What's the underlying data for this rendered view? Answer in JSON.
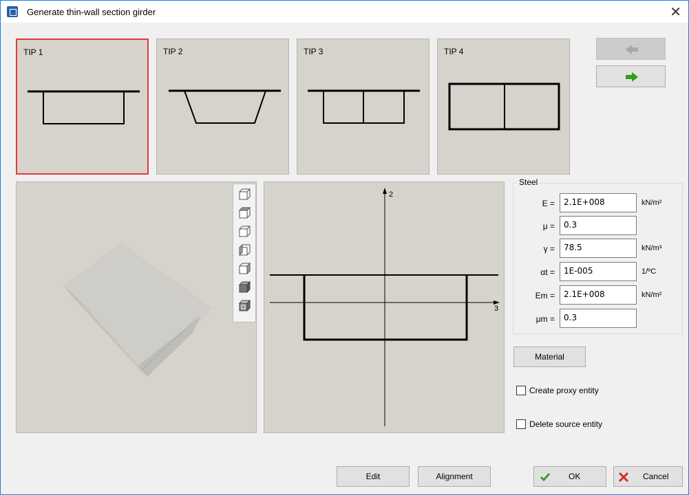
{
  "window": {
    "title": "Generate thin-wall section girder"
  },
  "tips": [
    {
      "label": "TIP 1",
      "selected": true
    },
    {
      "label": "TIP 2",
      "selected": false
    },
    {
      "label": "TIP 3",
      "selected": false
    },
    {
      "label": "TIP 4",
      "selected": false
    }
  ],
  "nav": {
    "back_icon": "arrow-left-icon",
    "forward_icon": "arrow-right-icon",
    "back_enabled": false,
    "forward_enabled": true
  },
  "view_toolbar": [
    "view-top-icon",
    "view-front-icon",
    "view-left-icon",
    "view-right-icon",
    "view-back-icon",
    "view-shaded-icon",
    "view-wire-shaded-icon"
  ],
  "section_view": {
    "axis_vertical": "2",
    "axis_horizontal": "3"
  },
  "steel": {
    "title": "Steel",
    "rows": [
      {
        "label": "E =",
        "value": "2.1E+008",
        "unit": "kN/m²"
      },
      {
        "label": "μ =",
        "value": "0.3",
        "unit": ""
      },
      {
        "label": "γ =",
        "value": "78.5",
        "unit": "kN/m³"
      },
      {
        "label": "αt =",
        "value": "1E-005",
        "unit": "1/ºC"
      },
      {
        "label": "Em =",
        "value": "2.1E+008",
        "unit": "kN/m²"
      },
      {
        "label": "μm =",
        "value": "0.3",
        "unit": ""
      }
    ]
  },
  "material_button": "Material",
  "checkboxes": [
    {
      "label": "Create proxy entity",
      "checked": false
    },
    {
      "label": "Delete source entity",
      "checked": false
    }
  ],
  "buttons": {
    "edit": "Edit",
    "alignment": "Alignment",
    "ok": "OK",
    "cancel": "Cancel"
  },
  "colors": {
    "accent_border": "#1a7fd8",
    "selected_tip": "#e23b3b",
    "ok_check": "#3a9a2e",
    "cancel_x": "#d62b2b",
    "forward_arrow": "#2e9e1d"
  }
}
